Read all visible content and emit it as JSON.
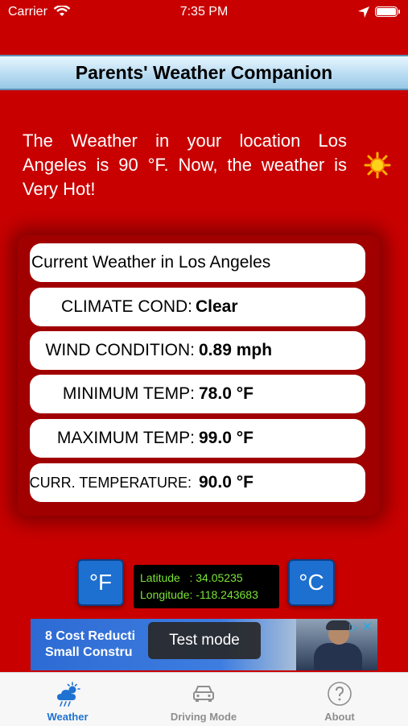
{
  "status_bar": {
    "carrier": "Carrier",
    "time": "7:35 PM"
  },
  "header": {
    "title": "Parents' Weather Companion"
  },
  "summary": {
    "text": "The Weather in your location Los Angeles is 90 °F. Now, the weather is Very Hot!"
  },
  "weather_card": {
    "title": "Current Weather in  Los Angeles",
    "rows": [
      {
        "label": "CLIMATE COND:",
        "value": "Clear"
      },
      {
        "label": "WIND CONDITION:",
        "value": "0.89 mph"
      },
      {
        "label": "MINIMUM TEMP:",
        "value": "78.0 °F"
      },
      {
        "label": "MAXIMUM TEMP:",
        "value": "99.0 °F"
      },
      {
        "label": "CURR. TEMPERATURE:",
        "value": "90.0 °F"
      }
    ]
  },
  "units": {
    "fahrenheit_label": "°F",
    "celsius_label": "°C"
  },
  "coordinates": {
    "latitude": "Latitude   : 34.05235",
    "longitude": "Longitude: -118.243683"
  },
  "ad": {
    "line1": "8 Cost Reducti",
    "line2": "Small Constru",
    "toast": "Test mode"
  },
  "tabs": [
    {
      "label": "Weather",
      "icon": "cloud-sun-icon",
      "active": true
    },
    {
      "label": "Driving Mode",
      "icon": "car-icon",
      "active": false
    },
    {
      "label": "About",
      "icon": "question-circle-icon",
      "active": false
    }
  ],
  "colors": {
    "background": "#c90000",
    "accent": "#1e73d2",
    "coord_text": "#7be337"
  }
}
